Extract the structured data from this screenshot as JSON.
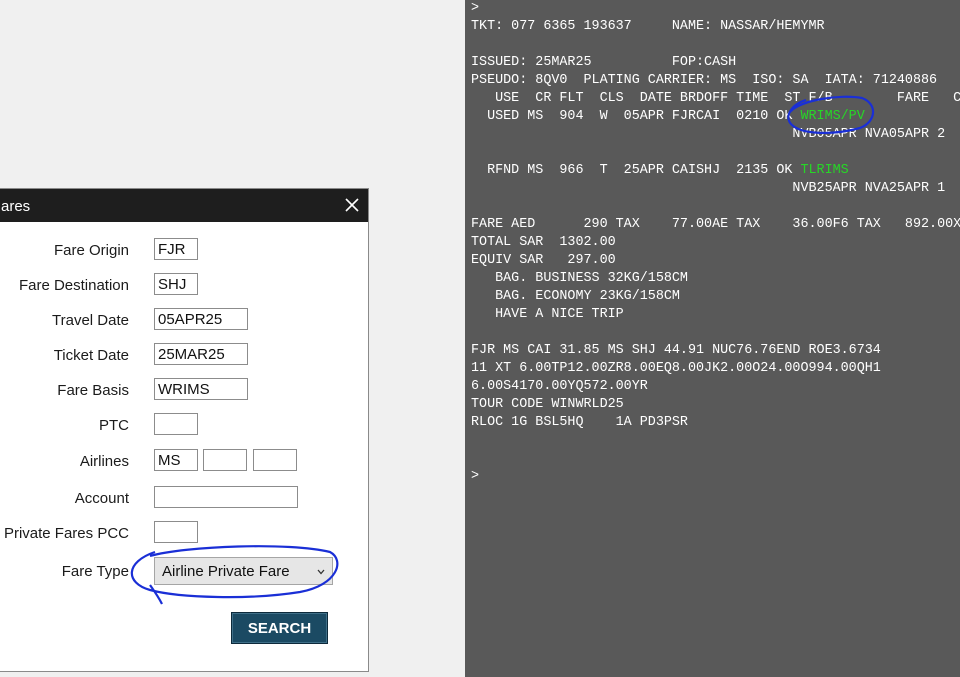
{
  "dialog": {
    "title": "ares",
    "fields": {
      "fare_origin": {
        "label": "Fare Origin",
        "value": "FJR"
      },
      "fare_destination": {
        "label": "Fare Destination",
        "value": "SHJ"
      },
      "travel_date": {
        "label": "Travel Date",
        "value": "05APR25"
      },
      "ticket_date": {
        "label": "Ticket Date",
        "value": "25MAR25"
      },
      "fare_basis": {
        "label": "Fare Basis",
        "value": "WRIMS"
      },
      "ptc": {
        "label": "PTC",
        "value": ""
      },
      "airlines": {
        "label": "Airlines",
        "values": [
          "MS",
          "",
          ""
        ]
      },
      "account": {
        "label": "Account",
        "value": ""
      },
      "private_fares_pcc": {
        "label": "Private Fares PCC",
        "value": ""
      },
      "fare_type": {
        "label": "Fare Type",
        "value": "Airline Private Fare"
      }
    },
    "search_label": "SEARCH",
    "icons": {
      "close": "close-icon",
      "dropdown": "chevron-down-icon"
    }
  },
  "terminal": {
    "lines": {
      "l0": ">",
      "l1": "TKT: 077 6365 193637     NAME: NASSAR/HEMYMR",
      "l2": "",
      "l3": "ISSUED: 25MAR25          FOP:CASH",
      "l4": "PSEUDO: 8QV0  PLATING CARRIER: MS  ISO: SA  IATA: 71240886",
      "l5": "   USE  CR FLT  CLS  DATE BRDOFF TIME  ST F/B        FARE   C",
      "l6a": "  USED MS  904  W  05APR FJRCAI  0210 OK ",
      "l6b": "WRIMS/PV",
      "l7": "                                        NVB05APR NVA05APR 2",
      "l8": "",
      "l9a": "  RFND MS  966  T  25APR CAISHJ  2135 OK ",
      "l9b": "TLRIMS",
      "l10": "                                        NVB25APR NVA25APR 1",
      "l11": "",
      "l12": "FARE AED      290 TAX    77.00AE TAX    36.00F6 TAX   892.00X",
      "l13": "TOTAL SAR  1302.00",
      "l14": "EQUIV SAR   297.00",
      "l15": "   BAG. BUSINESS 32KG/158CM",
      "l16": "   BAG. ECONOMY 23KG/158CM",
      "l17": "   HAVE A NICE TRIP",
      "l18": "",
      "l19": "FJR MS CAI 31.85 MS SHJ 44.91 NUC76.76END ROE3.6734",
      "l20": "11 XT 6.00TP12.00ZR8.00EQ8.00JK2.00O24.00O994.00QH1",
      "l21": "6.00S4170.00YQ572.00YR",
      "l22": "TOUR CODE WINWRLD25",
      "l23": "RLOC 1G BSL5HQ    1A PD3PSR",
      "l24": "",
      "l25": "",
      "l26": ">"
    },
    "colors": {
      "background": "#595959",
      "text": "#ffffff",
      "highlight": "#27d627"
    }
  },
  "annotation_color": "#1a2fd6"
}
